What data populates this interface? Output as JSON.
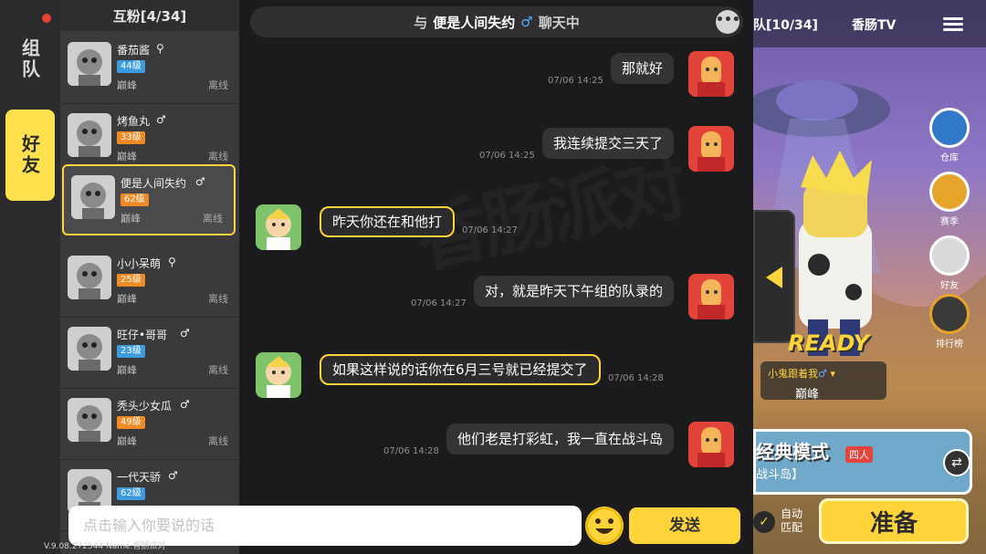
{
  "rail": {
    "team_tab": "组队",
    "friends_tab": "好友"
  },
  "friends": {
    "header": "互粉[4/34]",
    "items": [
      {
        "name": "番茄酱",
        "gender_icon": "search-icon",
        "level": "44级",
        "level_color": "blue",
        "rank": "巅峰",
        "status": "离线"
      },
      {
        "name": "烤鱼丸",
        "gender": "♂",
        "level": "33级",
        "level_color": "orange",
        "rank": "巅峰",
        "status": "离线"
      },
      {
        "name": "便是人间失约",
        "gender": "♂",
        "level": "62级",
        "level_color": "orange",
        "rank": "巅峰",
        "status": "离线",
        "selected": true
      },
      {
        "name": "小小呆萌",
        "gender_icon": "search-icon",
        "level": "25级",
        "level_color": "orange",
        "rank": "巅峰",
        "status": "离线"
      },
      {
        "name": "旺仔•哥哥",
        "gender": "♂",
        "level": "23级",
        "level_color": "blue",
        "rank": "巅峰",
        "status": "离线"
      },
      {
        "name": "秃头少女瓜",
        "gender": "♂",
        "level": "49级",
        "level_color": "orange",
        "rank": "巅峰",
        "status": "离线"
      },
      {
        "name": "一代天骄",
        "gender": "♂",
        "level": "62级",
        "level_color": "blue",
        "rank": "",
        "status": ""
      }
    ]
  },
  "chat": {
    "prefix": "与",
    "partner": "便是人间失约",
    "partner_gender": "♂",
    "suffix": "聊天中",
    "more_label": "•••",
    "messages": [
      {
        "side": "mine",
        "text": "那就好",
        "time": "07/06 14:25"
      },
      {
        "side": "mine",
        "text": "我连续提交三天了",
        "time": "07/06 14:25"
      },
      {
        "side": "theirs",
        "text": "昨天你还在和他打",
        "time": "07/06 14:27"
      },
      {
        "side": "mine",
        "text": "对，就是昨天下午组的队录的",
        "time": "07/06 14:27"
      },
      {
        "side": "theirs",
        "text": "如果这样说的话你在6月三号就已经提交了",
        "time": "07/06 14:28"
      },
      {
        "side": "mine",
        "text": "他们老是打彩虹，我一直在战斗岛",
        "time": "07/06 14:28"
      }
    ],
    "input_placeholder": "点击输入你要说的话",
    "send_label": "发送"
  },
  "version": "V.9.08.272544 Name:香肠派对",
  "scene": {
    "team_label": "队[10/34]",
    "channel_label": "香肠TV",
    "side_buttons": [
      {
        "label": "仓库",
        "icon": "warehouse-icon"
      },
      {
        "label": "赛季",
        "icon": "season-trophy-icon"
      },
      {
        "label": "好友",
        "icon": "friends-icon"
      },
      {
        "label": "排行榜",
        "icon": "leaderboard-icon"
      }
    ],
    "ready_text": "READY",
    "follower_text": "小鬼跟着我",
    "follower_gender": "♂",
    "rank_text": "巅峰",
    "mode_title": "经典模式",
    "mode_players": "四人",
    "mode_map": "战斗岛】",
    "auto_match": "自动\n匹配",
    "auto_match_l1": "自动",
    "auto_match_l2": "匹配",
    "ready_button": "准备"
  },
  "colors": {
    "accent": "#ffd43b",
    "level_blue": "#3d9be0",
    "level_orange": "#f08a24",
    "male": "#5aa9ff"
  }
}
